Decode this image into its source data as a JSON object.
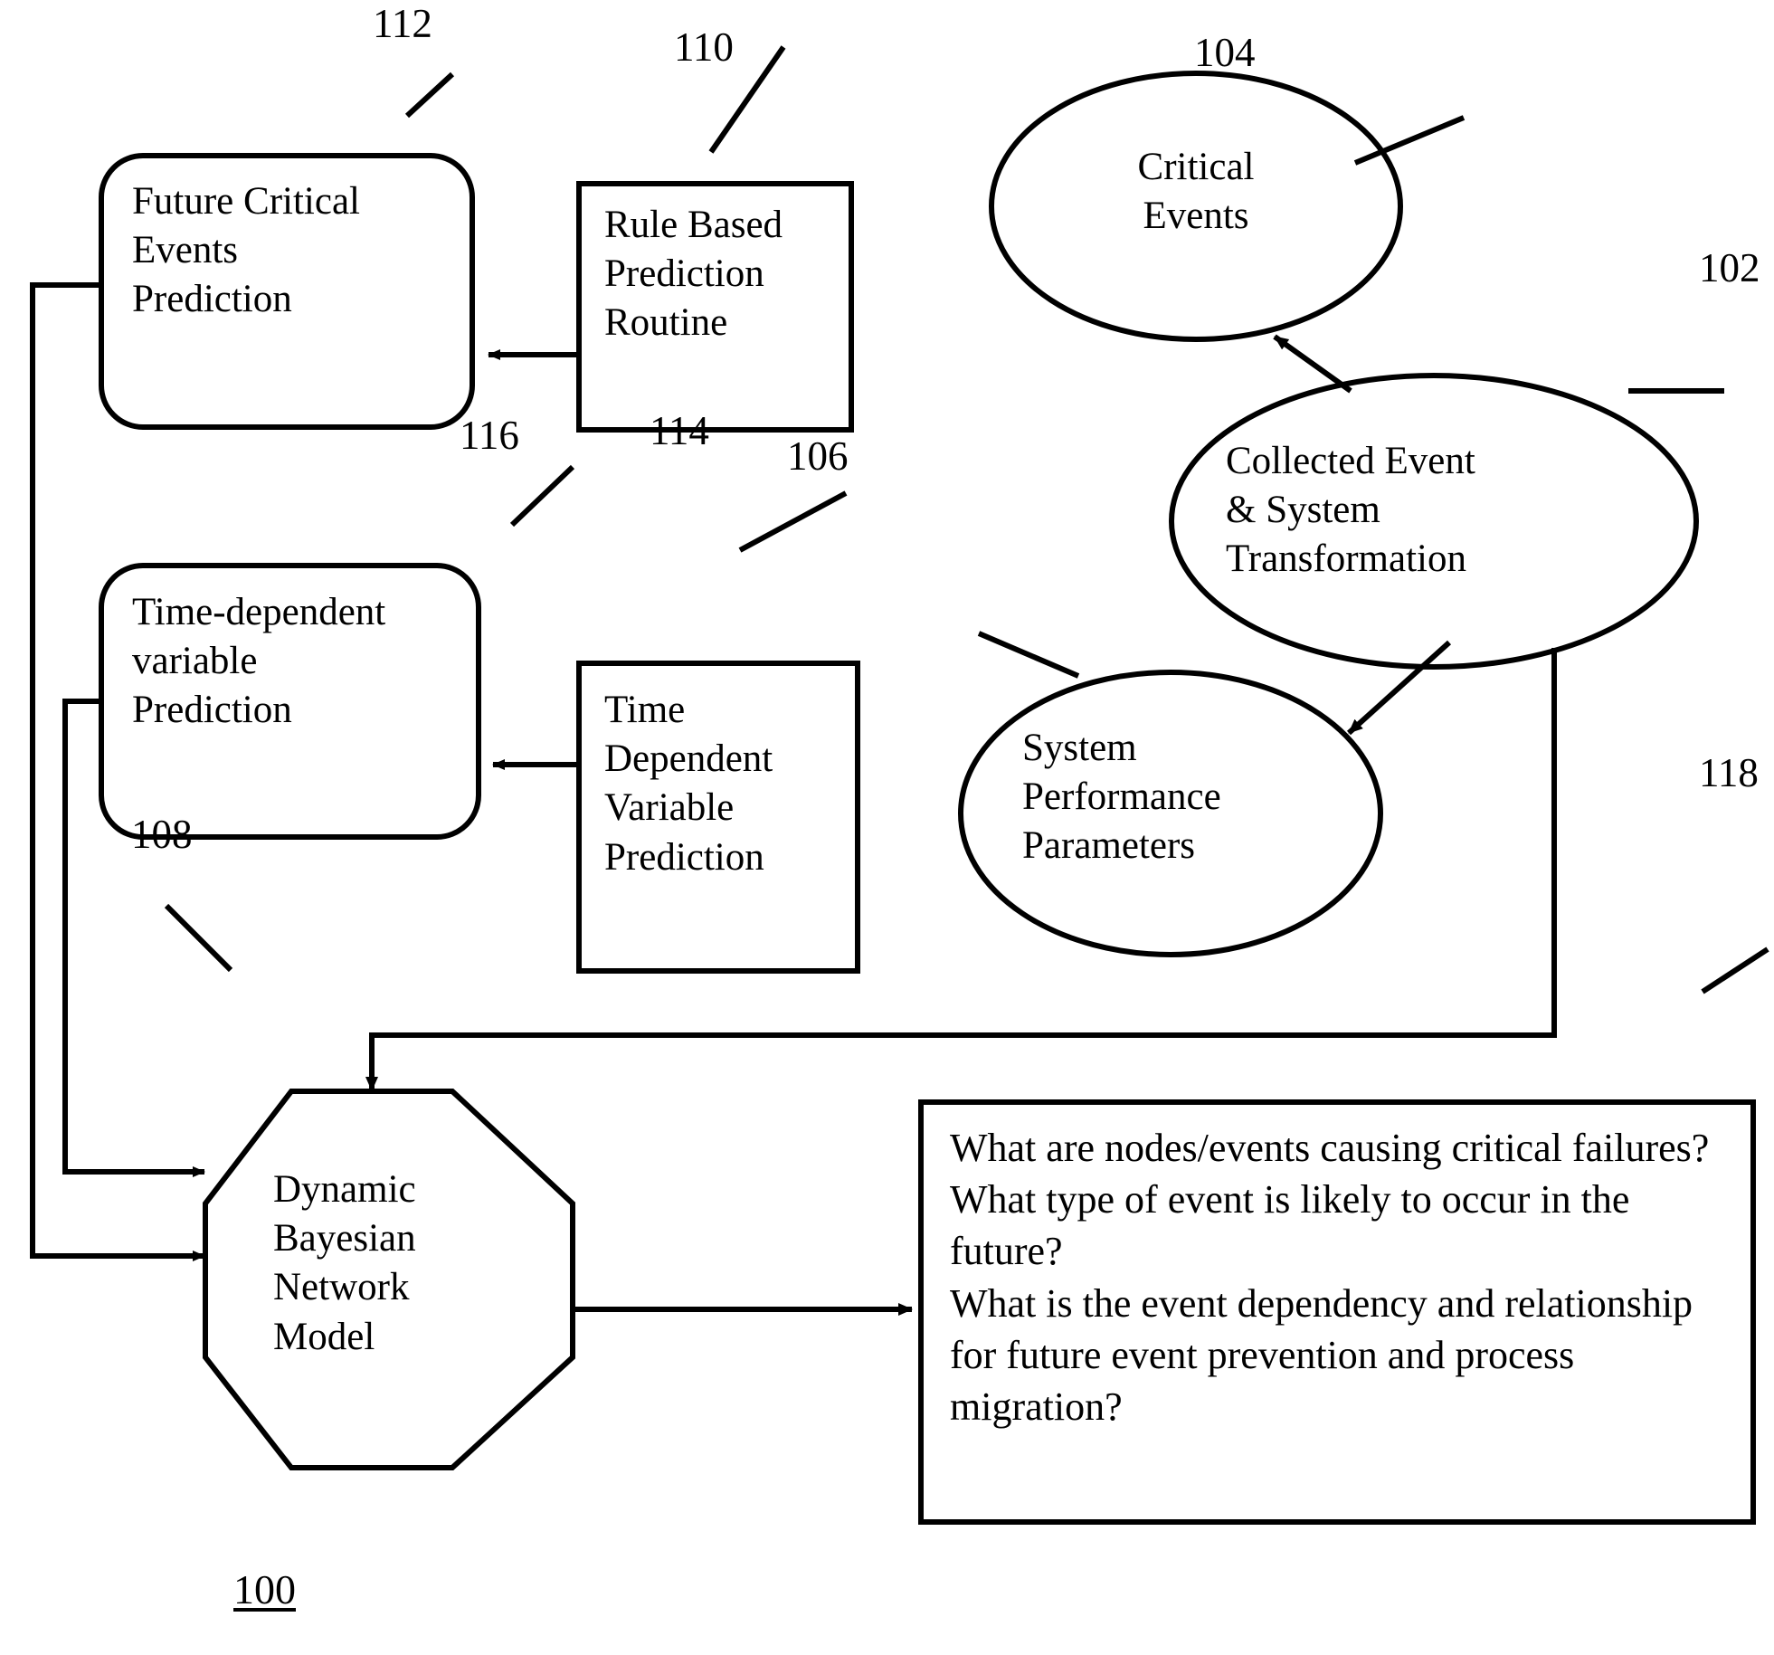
{
  "figure": {
    "figure_number": "100",
    "background": "#ffffff",
    "stroke_color": "#000000"
  },
  "nodes": {
    "future_critical_events_prediction": {
      "label": "Future Critical\nEvents\nPrediction",
      "ref": "112",
      "shape": "rounded-rectangle"
    },
    "rule_based_prediction_routine": {
      "label": "Rule Based\nPrediction\nRoutine",
      "ref": "110",
      "shape": "rectangle"
    },
    "critical_events": {
      "label": "Critical\nEvents",
      "ref": "104",
      "shape": "ellipse"
    },
    "collected_event_system_transformation": {
      "label": "Collected Event\n& System\nTransformation",
      "ref": "102",
      "shape": "ellipse"
    },
    "time_dependent_variable_prediction": {
      "label": "Time-dependent\nvariable\nPrediction",
      "ref": "116",
      "shape": "rounded-rectangle"
    },
    "time_dependent_variable_prediction_routine": {
      "label": "Time\nDependent\nVariable\nPrediction",
      "ref": "114",
      "shape": "rectangle"
    },
    "system_performance_parameters": {
      "label": "System\nPerformance\nParameters",
      "ref": "106",
      "shape": "ellipse"
    },
    "dynamic_bayesian_network_model": {
      "label": "Dynamic\nBayesian\nNetwork\nModel",
      "ref": "108",
      "shape": "octagon"
    },
    "questions_output": {
      "ref": "118",
      "shape": "rectangle",
      "lines": [
        "What are nodes/events causing critical",
        "failures?",
        "What type of event is likely to occur in",
        "the future?",
        "What is the event dependency and",
        "relationship for future event prevention",
        "and process migration?"
      ],
      "text": "What are nodes/events causing critical failures?\nWhat type of event is likely to occur in the future?\nWhat is the event dependency and relationship for future event prevention and process migration?"
    }
  },
  "reference_numerals": {
    "n112": "112",
    "n110": "110",
    "n104": "104",
    "n102": "102",
    "n116": "116",
    "n114": "114",
    "n106": "106",
    "n108": "108",
    "n118": "118",
    "n100": "100"
  }
}
